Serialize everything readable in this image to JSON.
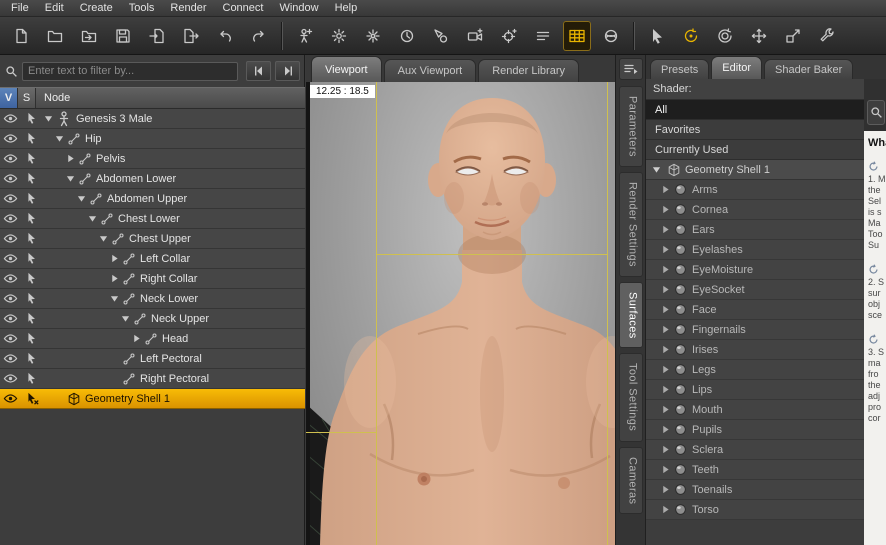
{
  "menubar": {
    "items": [
      "File",
      "Edit",
      "Create",
      "Tools",
      "Render",
      "Connect",
      "Window",
      "Help"
    ]
  },
  "toolbar": {
    "buttons": [
      {
        "name": "new-file",
        "icon": "doc"
      },
      {
        "name": "open-file",
        "icon": "folder"
      },
      {
        "name": "open-recent",
        "icon": "folder-arrow"
      },
      {
        "name": "save",
        "icon": "floppy"
      },
      {
        "name": "import",
        "icon": "import"
      },
      {
        "name": "export",
        "icon": "export"
      },
      {
        "name": "undo",
        "icon": "undo"
      },
      {
        "name": "redo",
        "icon": "redo"
      },
      {
        "sep": true
      },
      {
        "name": "create-figure",
        "icon": "figure-add"
      },
      {
        "name": "create-distant-light",
        "icon": "light-rays"
      },
      {
        "name": "create-point-light",
        "icon": "light-burst"
      },
      {
        "name": "create-linear-point-light",
        "icon": "clock"
      },
      {
        "name": "create-spotlight",
        "icon": "spotlight"
      },
      {
        "name": "create-camera",
        "icon": "camera-add"
      },
      {
        "name": "create-null",
        "icon": "target-add"
      },
      {
        "name": "scene-list",
        "icon": "list"
      },
      {
        "name": "texture-shaded",
        "icon": "grid",
        "active": true,
        "accent": "#e8b400"
      },
      {
        "name": "iray-preview",
        "icon": "sphere-swirl"
      },
      {
        "sep": true
      },
      {
        "name": "node-selection-tool",
        "icon": "cursor"
      },
      {
        "name": "rotate-tool",
        "icon": "rotate",
        "accent": "#e8b400"
      },
      {
        "name": "universal-tool",
        "icon": "orbit"
      },
      {
        "name": "translate-tool",
        "icon": "move"
      },
      {
        "name": "scale-tool",
        "icon": "scale"
      },
      {
        "name": "preferences",
        "icon": "wrench"
      }
    ]
  },
  "scene": {
    "filter_placeholder": "Enter text to filter by...",
    "columns": {
      "v": "V",
      "s": "S",
      "node": "Node"
    },
    "tree": [
      {
        "label": "Genesis 3 Male",
        "indent": 0,
        "arrow": "open",
        "icon": "person"
      },
      {
        "label": "Hip",
        "indent": 1,
        "arrow": "open",
        "icon": "bone"
      },
      {
        "label": "Pelvis",
        "indent": 2,
        "arrow": "closed",
        "icon": "bone"
      },
      {
        "label": "Abdomen Lower",
        "indent": 2,
        "arrow": "open",
        "icon": "bone"
      },
      {
        "label": "Abdomen Upper",
        "indent": 3,
        "arrow": "open",
        "icon": "bone"
      },
      {
        "label": "Chest Lower",
        "indent": 4,
        "arrow": "open",
        "icon": "bone"
      },
      {
        "label": "Chest Upper",
        "indent": 5,
        "arrow": "open",
        "icon": "bone"
      },
      {
        "label": "Left Collar",
        "indent": 6,
        "arrow": "closed",
        "icon": "bone"
      },
      {
        "label": "Right Collar",
        "indent": 6,
        "arrow": "closed",
        "icon": "bone"
      },
      {
        "label": "Neck Lower",
        "indent": 6,
        "arrow": "open",
        "icon": "bone"
      },
      {
        "label": "Neck Upper",
        "indent": 7,
        "arrow": "open",
        "icon": "bone"
      },
      {
        "label": "Head",
        "indent": 8,
        "arrow": "closed",
        "icon": "bone"
      },
      {
        "label": "Left Pectoral",
        "indent": 6,
        "arrow": "none",
        "icon": "bone"
      },
      {
        "label": "Right Pectoral",
        "indent": 6,
        "arrow": "none",
        "icon": "bone"
      },
      {
        "label": "Geometry Shell 1",
        "indent": 1,
        "arrow": "none",
        "icon": "shell",
        "selected": true
      }
    ]
  },
  "viewport": {
    "tabs": [
      "Viewport",
      "Aux Viewport",
      "Render Library"
    ],
    "active_tab": "Viewport",
    "coordinates": "12.25 : 18.5",
    "side_tabs": [
      "Parameters",
      "Render Settings",
      "Surfaces",
      "Tool Settings",
      "Cameras"
    ],
    "active_side_tab": "Surfaces"
  },
  "surfaces": {
    "tabs": [
      "Presets",
      "Editor",
      "Shader Baker"
    ],
    "active_tab": "Editor",
    "shader_label": "Shader:",
    "filter_options": [
      "All",
      "Favorites",
      "Currently Used"
    ],
    "selected_option": "All",
    "root_node": "Geometry Shell 1",
    "surface_names": [
      "Arms",
      "Cornea",
      "Ears",
      "Eyelashes",
      "EyeMoisture",
      "EyeSocket",
      "Face",
      "Fingernails",
      "Irises",
      "Legs",
      "Lips",
      "Mouth",
      "Pupils",
      "Sclera",
      "Teeth",
      "Toenails",
      "Torso"
    ]
  },
  "help": {
    "heading": "What",
    "steps": [
      {
        "lines": [
          "1. M",
          "the",
          "Sel",
          "is s",
          "Ma",
          "Too",
          "Su"
        ]
      },
      {
        "lines": [
          "2. S",
          "sur",
          "obj",
          "sce"
        ]
      },
      {
        "lines": [
          "3. S",
          "ma",
          "fro",
          "the",
          "adj",
          "pro",
          "cor"
        ]
      }
    ]
  },
  "colors": {
    "selection_yellow_top": "#f8bb06",
    "selection_yellow_bottom": "#da9300",
    "guide_yellow": "#cfc04f",
    "header_blue": "#4a6fa5",
    "accent_gold": "#e8b400"
  }
}
